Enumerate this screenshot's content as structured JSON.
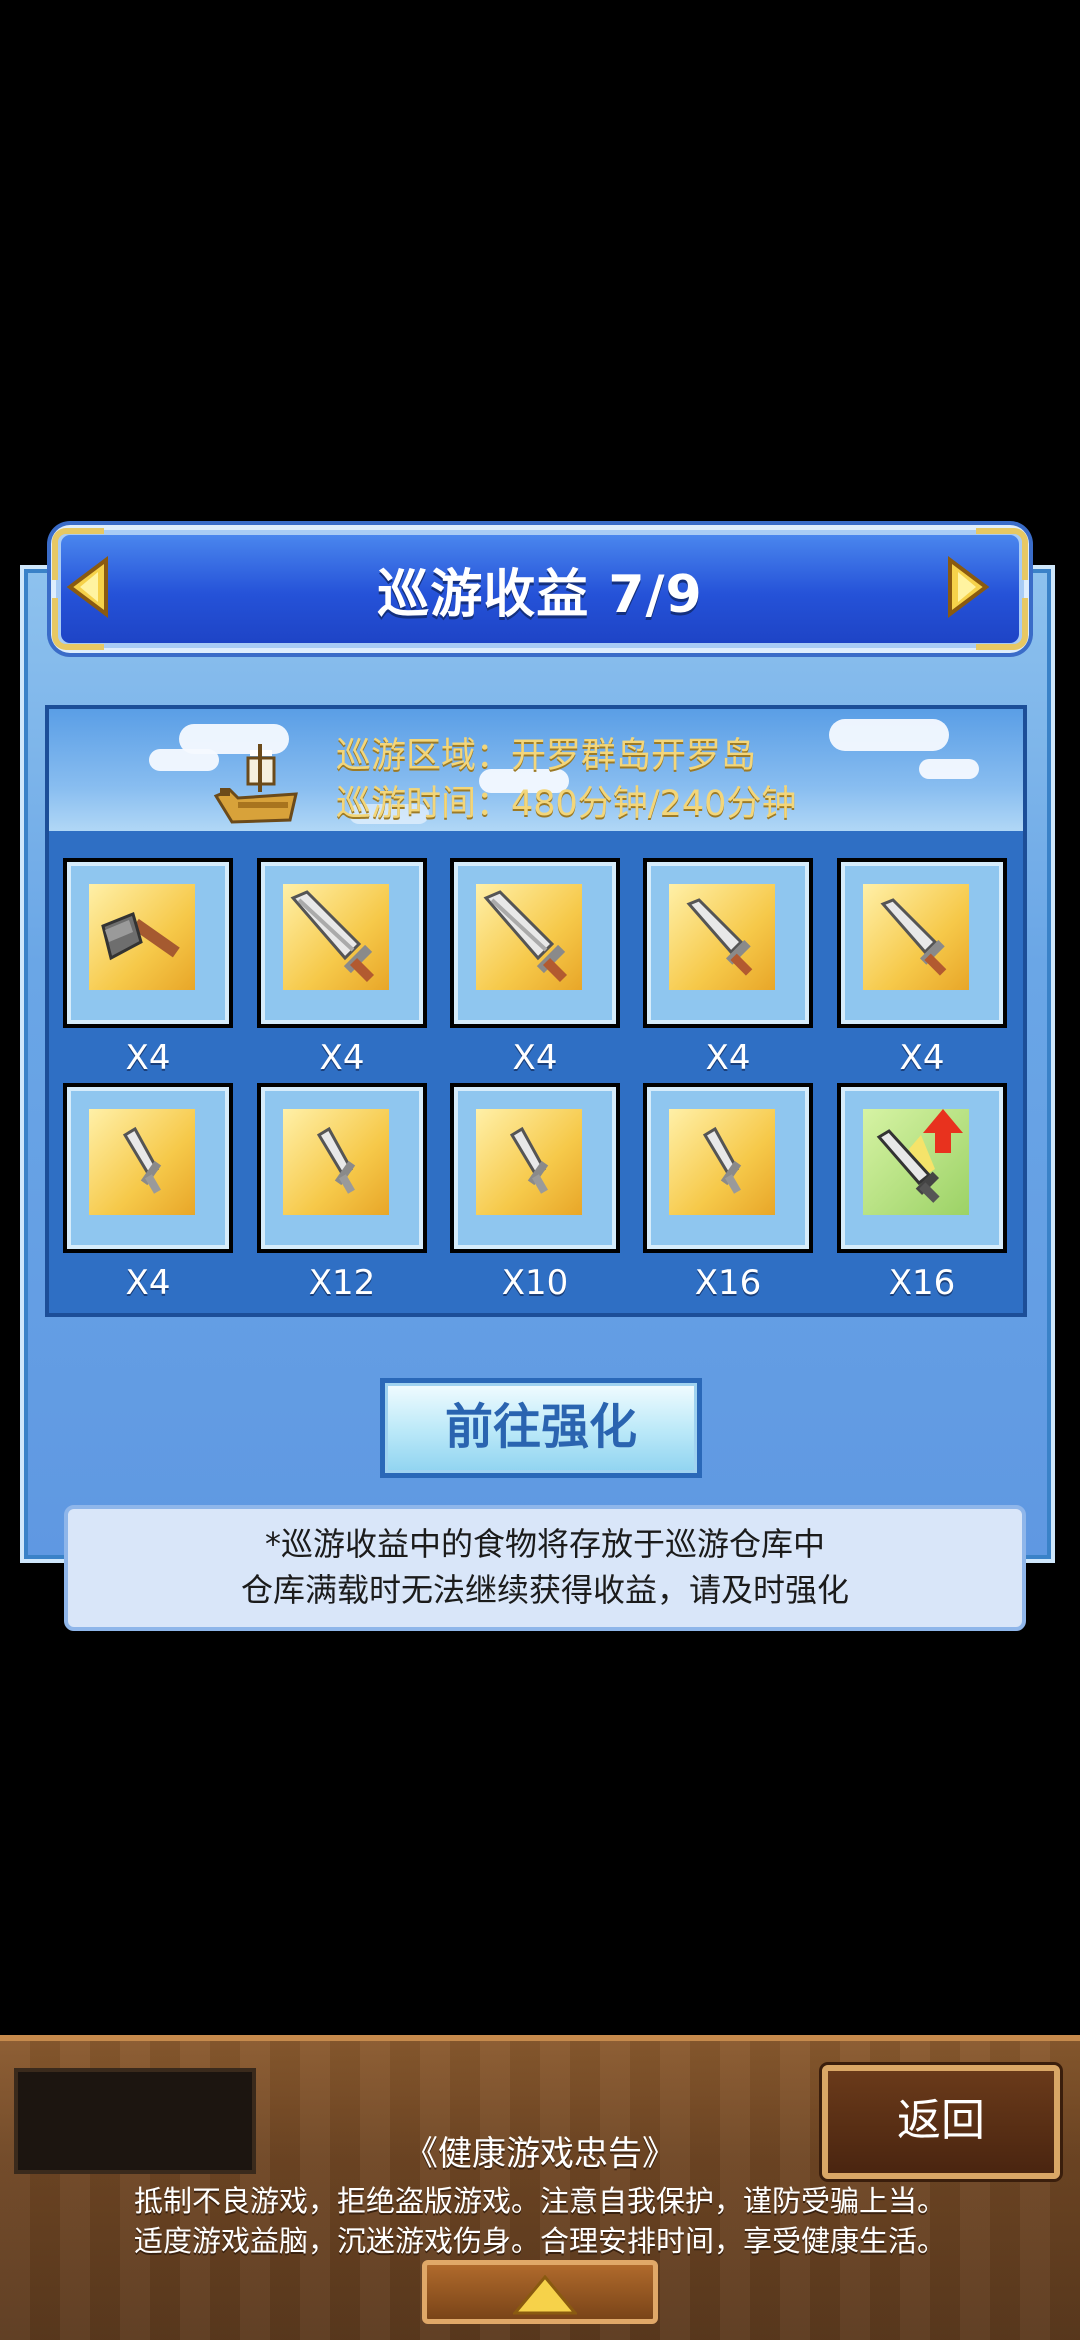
{
  "header": {
    "title": "巡游收益 7/9"
  },
  "cruise": {
    "region_label": "巡游区域：开罗群岛开罗岛",
    "time_label": "巡游时间：480分钟/240分钟"
  },
  "items": [
    {
      "icon": "axe-icon",
      "qty": "X4"
    },
    {
      "icon": "broadsword-icon",
      "qty": "X4"
    },
    {
      "icon": "broadsword-icon",
      "qty": "X4"
    },
    {
      "icon": "sword-icon",
      "qty": "X4"
    },
    {
      "icon": "sword-icon",
      "qty": "X4"
    },
    {
      "icon": "dagger-icon",
      "qty": "X4"
    },
    {
      "icon": "dagger-icon",
      "qty": "X12"
    },
    {
      "icon": "dagger-icon",
      "qty": "X10"
    },
    {
      "icon": "dagger-icon",
      "qty": "X16"
    },
    {
      "icon": "sword-upgrade-icon",
      "qty": "X16"
    }
  ],
  "actions": {
    "go_enhance": "前往强化",
    "back": "返回"
  },
  "notice": {
    "line1": "*巡游收益中的食物将存放于巡游仓库中",
    "line2": "仓库满载时无法继续获得收益，请及时强化"
  },
  "health": {
    "title": "《健康游戏忠告》",
    "line1": "抵制不良游戏，拒绝盗版游戏。注意自我保护，谨防受骗上当。",
    "line2": "适度游戏益脑，沉迷游戏伤身。合理安排时间，享受健康生活。"
  },
  "colors": {
    "accent_gold": "#f3d67a",
    "panel_blue": "#5f98e2",
    "wood": "#6f4624"
  }
}
